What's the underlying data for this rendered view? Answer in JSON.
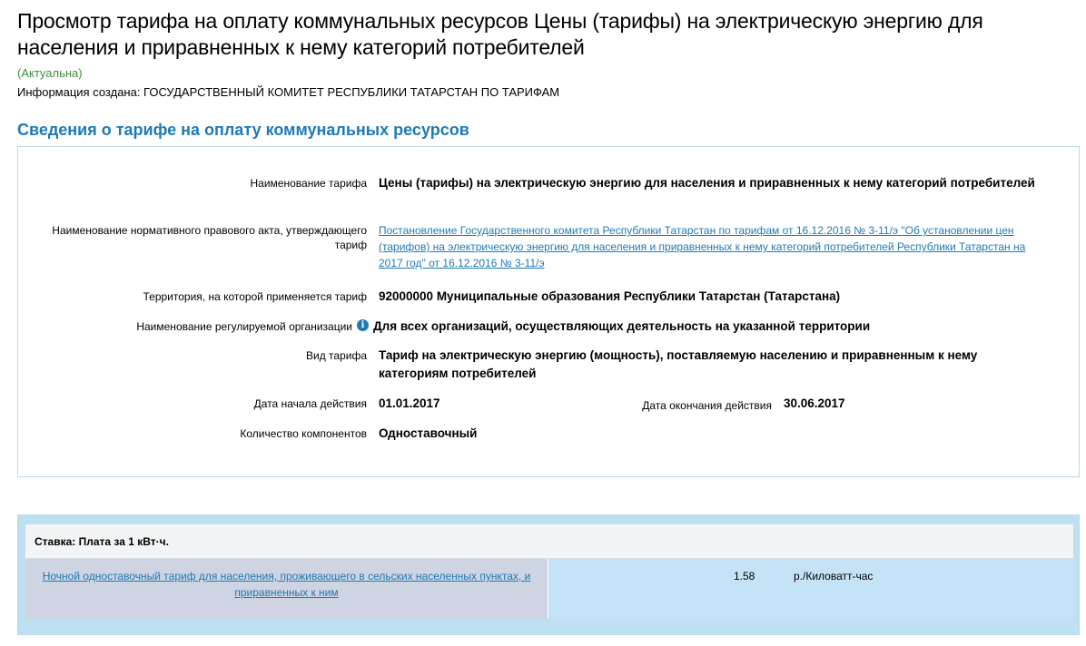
{
  "page": {
    "title": "Просмотр тарифа на оплату коммунальных ресурсов Цены (тарифы) на электрическую энергию для населения и приравненных к нему категорий потребителей",
    "status": "(Актуальна)",
    "created_by": "Информация создана: ГОСУДАРСТВЕННЫЙ КОМИТЕТ РЕСПУБЛИКИ ТАТАРСТАН ПО ТАРИФАМ"
  },
  "section": {
    "title": "Сведения о тарифе на оплату коммунальных ресурсов"
  },
  "fields": {
    "tariff_name_label": "Наименование тарифа",
    "tariff_name_value": "Цены (тарифы) на электрическую энергию для населения и приравненных к нему категорий потребителей",
    "act_label": "Наименование нормативного правового акта, утверждающего тариф",
    "act_link": "Постановление Государственного комитета Республики Татарстан по тарифам от 16.12.2016 № 3-11/э \"Об установлении цен (тарифов) на электрическую энергию для населения и приравненных к нему категорий потребителей Республики Татарстан на 2017 год\" от 16.12.2016 № 3-11/э",
    "territory_label": "Территория, на которой применяется тариф",
    "territory_value": "92000000 Муниципальные образования Республики Татарстан (Татарстана)",
    "org_label": "Наименование регулируемой организации",
    "org_info_icon": "i",
    "org_value": "Для всех организаций, осуществляющих деятельность на указанной территории",
    "type_label": "Вид тарифа",
    "type_value": "Тариф на электрическую энергию (мощность), поставляемую населению и приравненным к нему категориям потребителей",
    "start_label": "Дата начала действия",
    "start_value": "01.01.2017",
    "end_label": "Дата окончания действия",
    "end_value": "30.06.2017",
    "components_label": "Количество компонентов",
    "components_value": "Одноставочный"
  },
  "rate": {
    "header": "Ставка: Плата за 1 кВт·ч.",
    "row_name": "Ночной одноставочный тариф для населения, проживающего в сельских населенных пунктах, и приравненных к ним",
    "row_value": "1.58",
    "row_unit": "р./Киловатт-час"
  },
  "colors": {
    "accent": "#1e7ab5",
    "status": "#3e8e41",
    "box_border": "#b9dbe8",
    "rate_bg": "#bfdff3",
    "rate_name_bg": "#cfd4e2"
  }
}
